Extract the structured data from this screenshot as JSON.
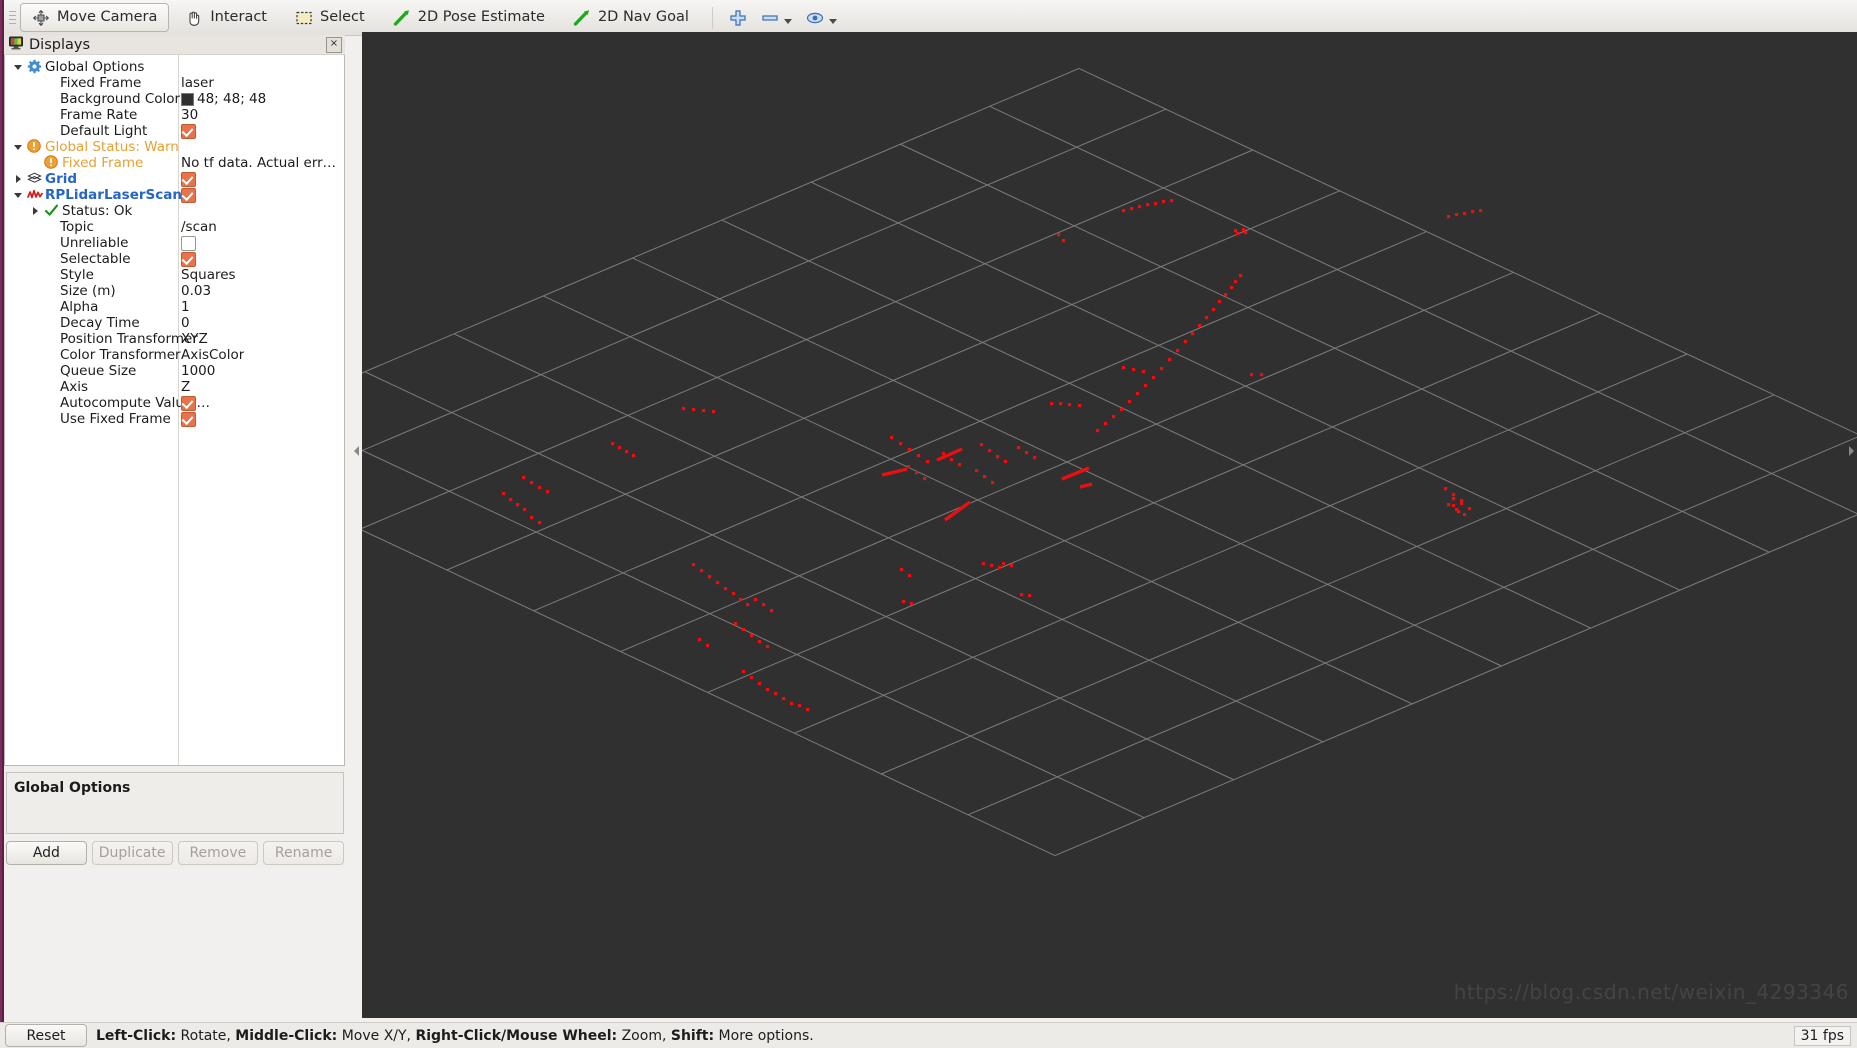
{
  "toolbar": {
    "tools": [
      {
        "label": "Move Camera",
        "icon": "move-camera-icon",
        "active": true
      },
      {
        "label": "Interact",
        "icon": "hand-icon",
        "active": false
      },
      {
        "label": "Select",
        "icon": "select-rect-icon",
        "active": false
      },
      {
        "label": "2D Pose Estimate",
        "icon": "pose-arrow-icon",
        "active": false
      },
      {
        "label": "2D Nav Goal",
        "icon": "nav-goal-arrow-icon",
        "active": false
      }
    ],
    "plus_icon": "plus-icon",
    "minus_icon": "minus-icon",
    "eye_icon": "eye-icon"
  },
  "displays_panel": {
    "title": "Displays",
    "title_icon": "monitor-icon",
    "close_label": "×",
    "rows": [
      {
        "indent": 0,
        "expander": "down",
        "icon": "gear-icon",
        "name": "Global Options",
        "value": "",
        "kind": "group",
        "style": "plain"
      },
      {
        "indent": 1,
        "expander": "none",
        "icon": "none",
        "name": "Fixed Frame",
        "value": "laser",
        "kind": "text",
        "style": "plain"
      },
      {
        "indent": 1,
        "expander": "none",
        "icon": "none",
        "name": "Background Color",
        "value": "48; 48; 48",
        "kind": "color",
        "style": "plain"
      },
      {
        "indent": 1,
        "expander": "none",
        "icon": "none",
        "name": "Frame Rate",
        "value": "30",
        "kind": "text",
        "style": "plain"
      },
      {
        "indent": 1,
        "expander": "none",
        "icon": "none",
        "name": "Default Light",
        "value": "",
        "kind": "check-on",
        "style": "plain"
      },
      {
        "indent": 0,
        "expander": "down",
        "icon": "warning-icon",
        "name": "Global Status: Warn",
        "value": "",
        "kind": "group",
        "style": "warn"
      },
      {
        "indent": 1,
        "expander": "none",
        "icon": "warning-icon",
        "name": "Fixed Frame",
        "value": "No tf data.  Actual error: Fi…",
        "kind": "text",
        "style": "warn"
      },
      {
        "indent": 0,
        "expander": "right",
        "icon": "grid-icon",
        "name": "Grid",
        "value": "",
        "kind": "check-on",
        "style": "blue"
      },
      {
        "indent": 0,
        "expander": "down",
        "icon": "laserscan-icon",
        "name": "RPLidarLaserScan",
        "value": "",
        "kind": "check-on",
        "style": "blue"
      },
      {
        "indent": 1,
        "expander": "right",
        "icon": "check-ok-icon",
        "name": "Status: Ok",
        "value": "",
        "kind": "none",
        "style": "plain"
      },
      {
        "indent": 1,
        "expander": "none",
        "icon": "none",
        "name": "Topic",
        "value": "/scan",
        "kind": "text",
        "style": "plain"
      },
      {
        "indent": 1,
        "expander": "none",
        "icon": "none",
        "name": "Unreliable",
        "value": "",
        "kind": "check-off",
        "style": "plain"
      },
      {
        "indent": 1,
        "expander": "none",
        "icon": "none",
        "name": "Selectable",
        "value": "",
        "kind": "check-on",
        "style": "plain"
      },
      {
        "indent": 1,
        "expander": "none",
        "icon": "none",
        "name": "Style",
        "value": "Squares",
        "kind": "text",
        "style": "plain"
      },
      {
        "indent": 1,
        "expander": "none",
        "icon": "none",
        "name": "Size (m)",
        "value": "0.03",
        "kind": "text",
        "style": "plain"
      },
      {
        "indent": 1,
        "expander": "none",
        "icon": "none",
        "name": "Alpha",
        "value": "1",
        "kind": "text",
        "style": "plain"
      },
      {
        "indent": 1,
        "expander": "none",
        "icon": "none",
        "name": "Decay Time",
        "value": "0",
        "kind": "text",
        "style": "plain"
      },
      {
        "indent": 1,
        "expander": "none",
        "icon": "none",
        "name": "Position Transformer",
        "value": "XYZ",
        "kind": "text",
        "style": "plain"
      },
      {
        "indent": 1,
        "expander": "none",
        "icon": "none",
        "name": "Color Transformer",
        "value": "AxisColor",
        "kind": "text",
        "style": "plain"
      },
      {
        "indent": 1,
        "expander": "none",
        "icon": "none",
        "name": "Queue Size",
        "value": "1000",
        "kind": "text",
        "style": "plain"
      },
      {
        "indent": 1,
        "expander": "none",
        "icon": "none",
        "name": "Axis",
        "value": "Z",
        "kind": "text",
        "style": "plain"
      },
      {
        "indent": 1,
        "expander": "none",
        "icon": "none",
        "name": "Autocompute Value …",
        "value": "",
        "kind": "check-on",
        "style": "plain"
      },
      {
        "indent": 1,
        "expander": "none",
        "icon": "none",
        "name": "Use Fixed Frame",
        "value": "",
        "kind": "check-on",
        "style": "plain"
      }
    ],
    "description_title": "Global Options",
    "buttons": [
      {
        "label": "Add",
        "enabled": true
      },
      {
        "label": "Duplicate",
        "enabled": false
      },
      {
        "label": "Remove",
        "enabled": false
      },
      {
        "label": "Rename",
        "enabled": false
      }
    ]
  },
  "view": {
    "background_color": "#303030",
    "grid_color": "#9a9a9a",
    "point_color": "#e81010",
    "watermark": "https://blog.csdn.net/weixin_4293346"
  },
  "statusbar": {
    "reset_label": "Reset",
    "hint_parts": [
      {
        "text": "Left-Click:",
        "bold": true
      },
      {
        "text": " Rotate, ",
        "bold": false
      },
      {
        "text": "Middle-Click:",
        "bold": true
      },
      {
        "text": " Move X/Y, ",
        "bold": false
      },
      {
        "text": "Right-Click/Mouse Wheel:",
        "bold": true
      },
      {
        "text": " Zoom, ",
        "bold": false
      },
      {
        "text": "Shift:",
        "bold": true
      },
      {
        "text": " More options.",
        "bold": false
      }
    ],
    "fps": "31 fps"
  }
}
